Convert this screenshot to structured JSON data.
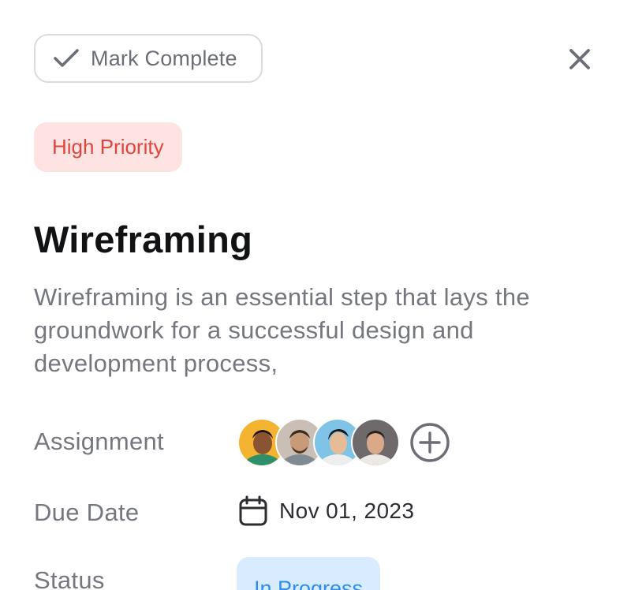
{
  "toolbar": {
    "mark_complete_label": "Mark Complete",
    "close_icon": "close-icon"
  },
  "task": {
    "priority": "High Priority",
    "title": "Wireframing",
    "description": "Wireframing is an essential step that lays the groundwork for a successful design and development process,"
  },
  "fields": {
    "assignment_label": "Assignment",
    "due_date_label": "Due Date",
    "status_label": "Status"
  },
  "assignees": [
    {
      "name": "avatar-1",
      "bg": "#f4b331"
    },
    {
      "name": "avatar-2",
      "bg": "#c9bfb4"
    },
    {
      "name": "avatar-3",
      "bg": "#7fc4e6"
    },
    {
      "name": "avatar-4",
      "bg": "#6e6a6b"
    }
  ],
  "due_date": "Nov 01, 2023",
  "status": "In Progress",
  "colors": {
    "priority_bg": "#fde4e3",
    "priority_text": "#e0453d",
    "status_bg": "#d8ebff",
    "status_text": "#2f8dee",
    "muted_text": "#75777e"
  }
}
